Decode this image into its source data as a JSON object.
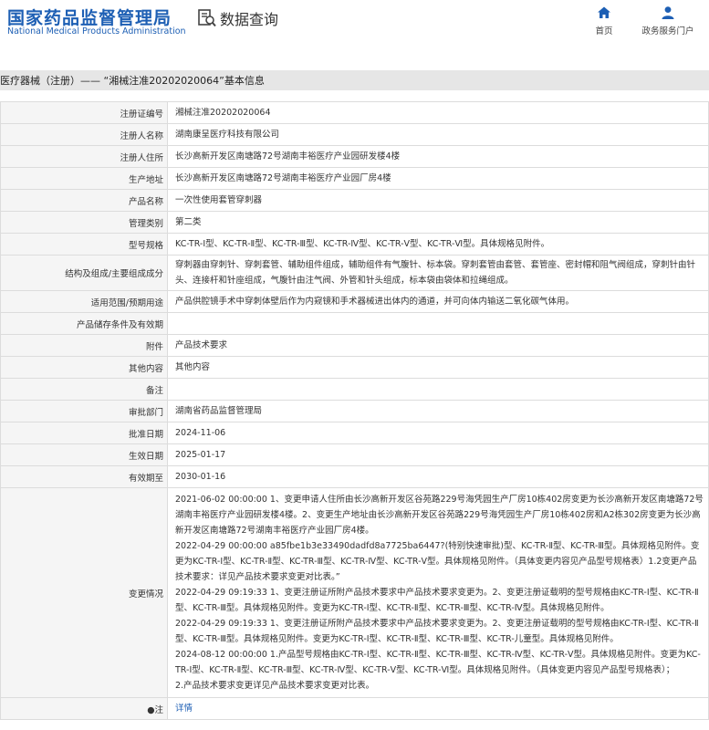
{
  "header": {
    "logo_cn": "国家药品监督管理局",
    "logo_en": "National Medical Products Administration",
    "search_title": "数据查询",
    "nav": [
      {
        "label": "首页",
        "icon": "home-icon"
      },
      {
        "label": "政务服务门户",
        "icon": "user-icon"
      }
    ]
  },
  "breadcrumb": "医疗器械（注册）—— “湘械注准20202020064”基本信息",
  "colors": {
    "brand": "#1d5fb4",
    "crumb_bg": "#e6e6e6",
    "label_bg": "#f5f5f5",
    "border": "#dcdcdc"
  },
  "rows": [
    {
      "label": "注册证编号",
      "value": "湘械注准20202020064"
    },
    {
      "label": "注册人名称",
      "value": "湖南康呈医疗科技有限公司"
    },
    {
      "label": "注册人住所",
      "value": "长沙高新开发区南塘路72号湖南丰裕医疗产业园研发楼4楼"
    },
    {
      "label": "生产地址",
      "value": "长沙高新开发区南塘路72号湖南丰裕医疗产业园厂房4楼"
    },
    {
      "label": "产品名称",
      "value": "一次性使用套管穿刺器"
    },
    {
      "label": "管理类别",
      "value": "第二类"
    },
    {
      "label": "型号规格",
      "value": "KC-TR-Ⅰ型、KC-TR-Ⅱ型、KC-TR-Ⅲ型、KC-TR-Ⅳ型、KC-TR-Ⅴ型、KC-TR-Ⅵ型。具体规格见附件。"
    },
    {
      "label": "结构及组成/主要组成成分",
      "value": "穿刺器由穿刺针、穿刺套管、辅助组件组成，辅助组件有气腹针、标本袋。穿刺套管由套管、套管座、密封帽和阻气阀组成，穿刺针由针头、连接杆和针座组成，气腹针由注气阀、外管和针头组成，标本袋由袋体和拉绳组成。"
    },
    {
      "label": "适用范围/预期用途",
      "value": "产品供腔镜手术中穿刺体壁后作为内窥镜和手术器械进出体内的通道，并可向体内输送二氧化碳气体用。"
    },
    {
      "label": "产品储存条件及有效期",
      "value": ""
    },
    {
      "label": "附件",
      "value": "产品技术要求"
    },
    {
      "label": "其他内容",
      "value": "其他内容"
    },
    {
      "label": "备注",
      "value": ""
    },
    {
      "label": "审批部门",
      "value": "湖南省药品监督管理局"
    },
    {
      "label": "批准日期",
      "value": "2024-11-06"
    },
    {
      "label": "生效日期",
      "value": "2025-01-17"
    },
    {
      "label": "有效期至",
      "value": "2030-01-16"
    }
  ],
  "change": {
    "label": "变更情况",
    "lines": [
      "2021-06-02 00:00:00 1、变更申请人住所由长沙高新开发区谷苑路229号海凭园生产厂房10栋402房变更为长沙高新开发区南塘路72号湖南丰裕医疗产业园研发楼4楼。2、变更生产地址由长沙高新开发区谷苑路229号海凭园生产厂房10栋402房和A2栋302房变更为长沙高新开发区南塘路72号湖南丰裕医疗产业园厂房4楼。",
      "2022-04-29 00:00:00 a85fbe1b3e33490dadfd8a7725ba6447?(特别快速审批)型、KC-TR-Ⅱ型、KC-TR-Ⅲ型。具体规格见附件。变更为KC-TR-Ⅰ型、KC-TR-Ⅱ型、KC-TR-Ⅲ型、KC-TR-Ⅳ型、KC-TR-Ⅴ型。具体规格见附件。（具体变更内容见产品型号规格表）1.2变更产品技术要求：详见产品技术要求变更对比表。”",
      "2022-04-29 09:19:33 1、变更注册证所附产品技术要求中产品技术要求变更为。2、变更注册证载明的型号规格由KC-TR-Ⅰ型、KC-TR-Ⅱ型、KC-TR-Ⅲ型。具体规格见附件。变更为KC-TR-Ⅰ型、KC-TR-Ⅱ型、KC-TR-Ⅲ型、KC-TR-Ⅳ型。具体规格见附件。",
      "2022-04-29 09:19:33 1、变更注册证所附产品技术要求中产品技术要求变更为。2、变更注册证载明的型号规格由KC-TR-Ⅰ型、KC-TR-Ⅱ型、KC-TR-Ⅲ型。具体规格见附件。变更为KC-TR-Ⅰ型、KC-TR-Ⅱ型、KC-TR-Ⅲ型、KC-TR-儿童型。具体规格见附件。",
      "2024-08-12 00:00:00 1.产品型号规格由KC-TR-Ⅰ型、KC-TR-Ⅱ型、KC-TR-Ⅲ型、KC-TR-Ⅳ型、KC-TR-Ⅴ型。具体规格见附件。变更为KC-TR-Ⅰ型、KC-TR-Ⅱ型、KC-TR-Ⅲ型、KC-TR-Ⅳ型、KC-TR-Ⅴ型、KC-TR-Ⅵ型。具体规格见附件。（具体变更内容见产品型号规格表）；",
      "2.产品技术要求变更详见产品技术要求变更对比表。"
    ]
  },
  "note": {
    "label": "●注",
    "link": "详情"
  }
}
